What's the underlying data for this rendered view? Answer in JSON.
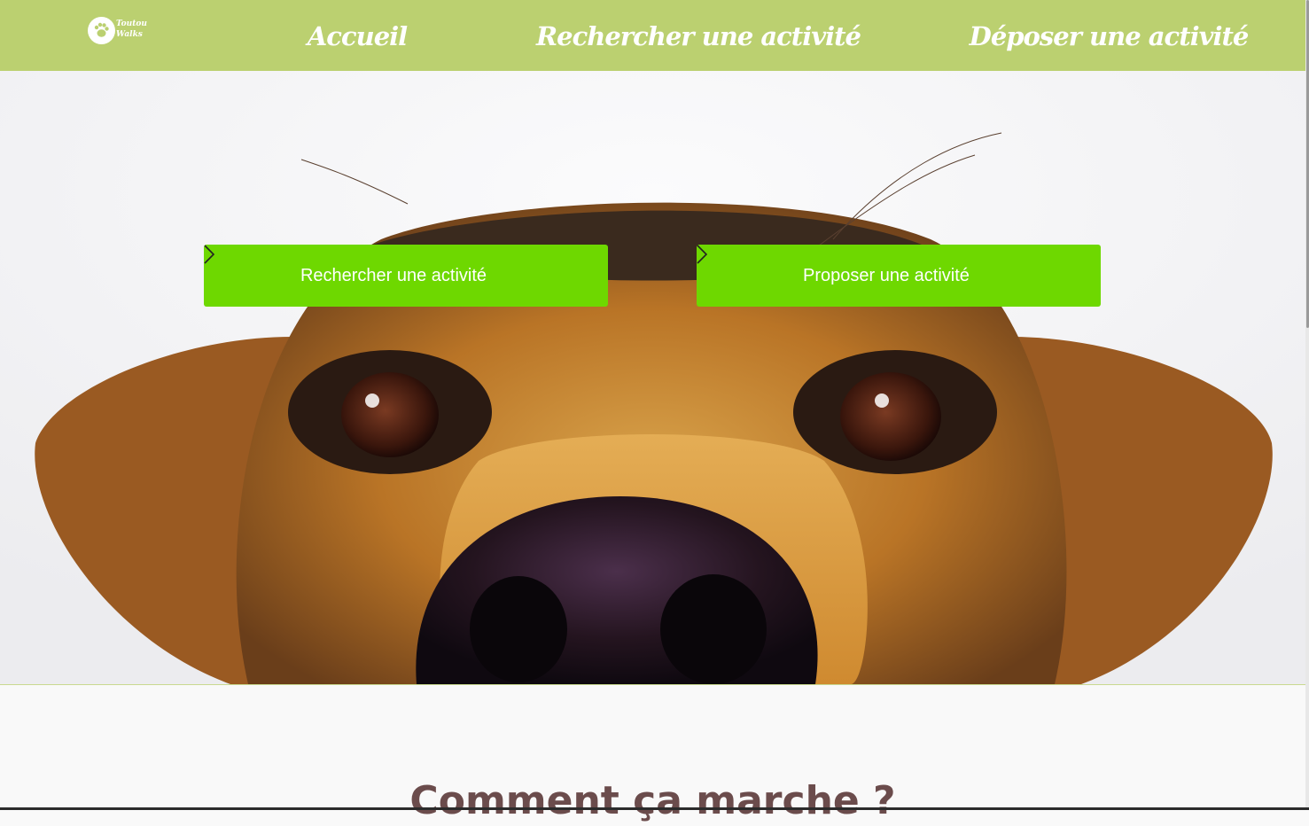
{
  "brand": {
    "logo_line1": "Toutou",
    "logo_line2": "Walks"
  },
  "nav": {
    "home": "Accueil",
    "search": "Rechercher une activité",
    "post": "Déposer une activité"
  },
  "hero": {
    "search_button": "Rechercher une activité",
    "propose_button": "Proposer une activité"
  },
  "section": {
    "title": "Comment ça marche ?"
  },
  "colors": {
    "navbar": "#bbd070",
    "cta": "#6ed800",
    "title": "#6b4c4c"
  }
}
